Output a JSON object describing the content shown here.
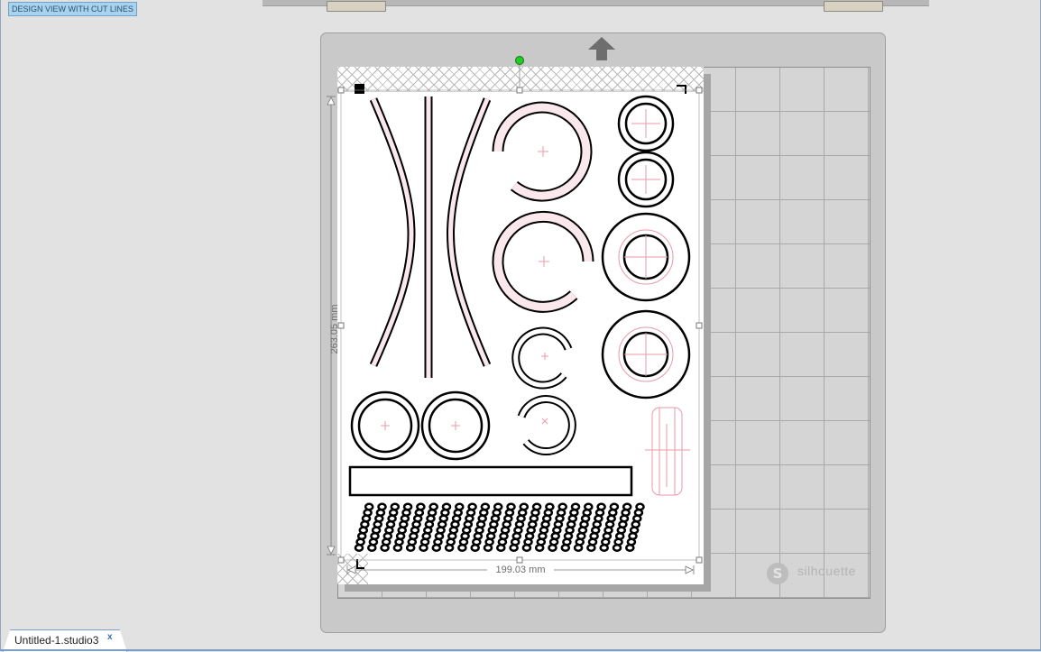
{
  "view_mode_label": "DESIGN VIEW WITH CUT LINES",
  "dimensions": {
    "height_label": "263.05 mm",
    "width_label": "199.03 mm"
  },
  "mat": {
    "brand": "silhouette",
    "brand_logo_letter": "S",
    "feed_arrow_icon": "up-arrow-icon"
  },
  "document_tab": {
    "title": "Untitled-1.studio3",
    "close_glyph": "x"
  },
  "colors": {
    "cut_line": "#000000",
    "registration": "#e89aa8",
    "selection_handle": "#ffffff",
    "rotate_handle": "#22cc22",
    "tab_border": "#7b9ec4"
  }
}
